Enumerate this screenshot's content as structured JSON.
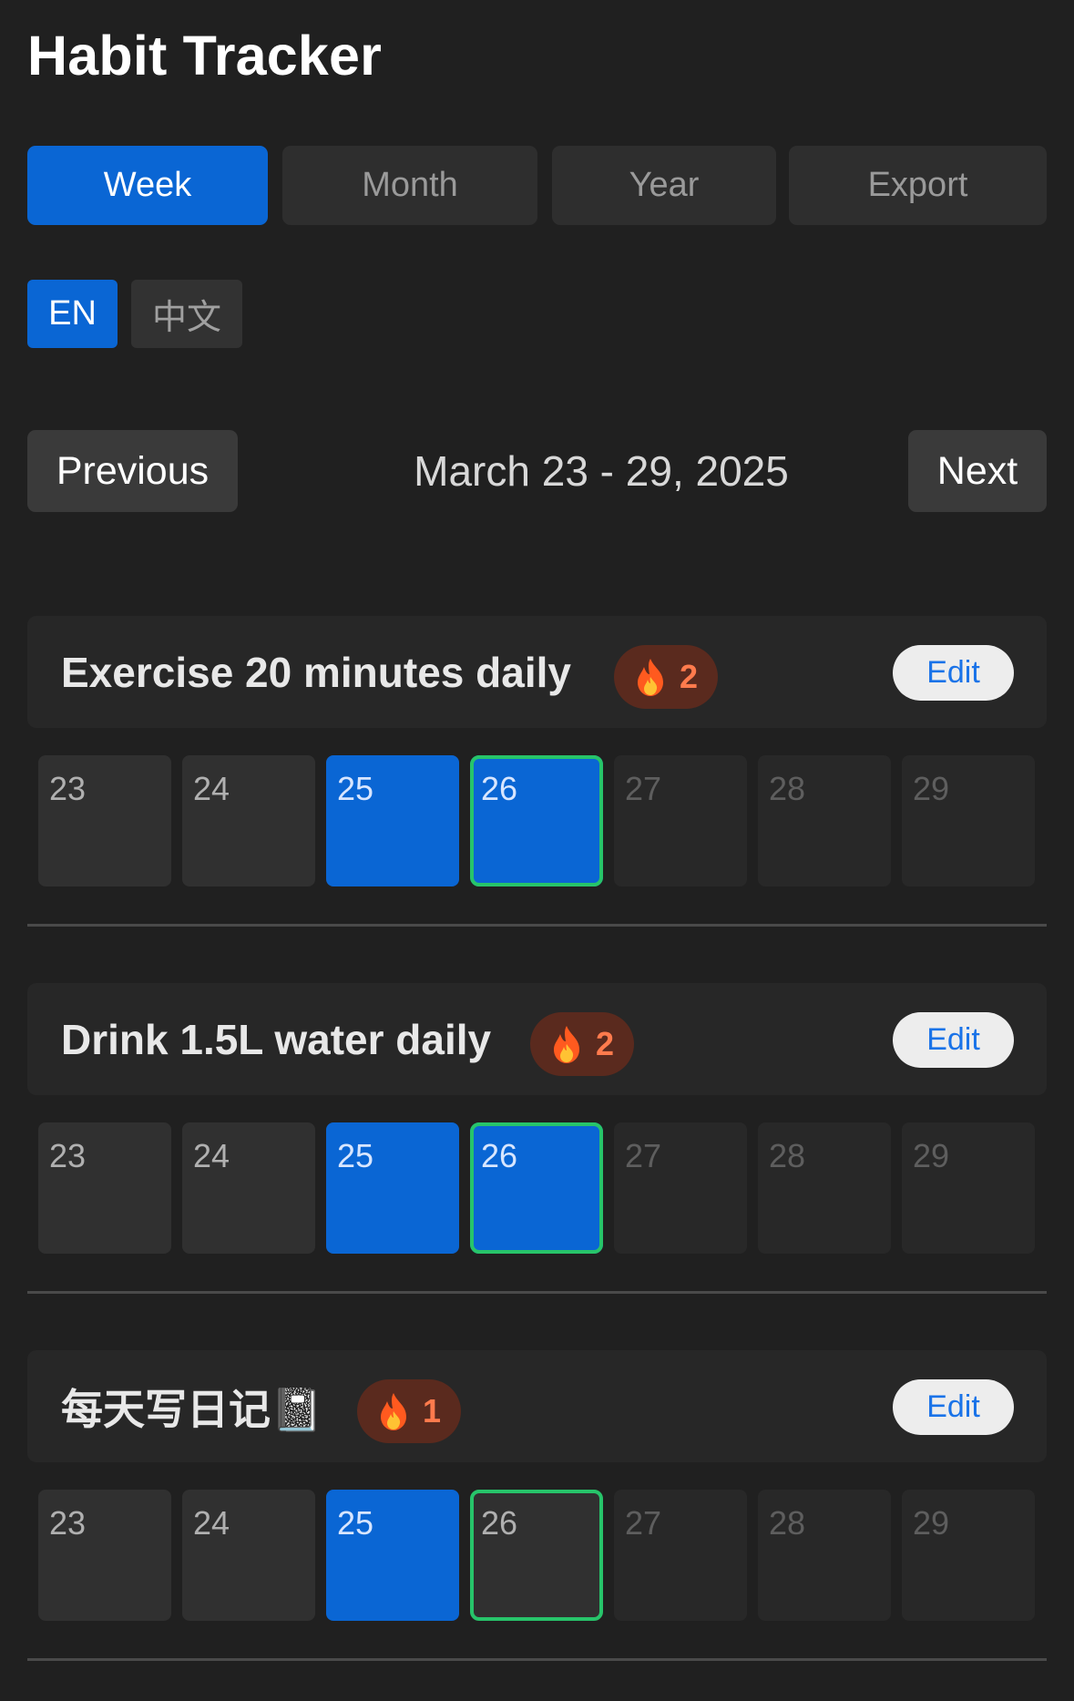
{
  "app": {
    "title": "Habit Tracker"
  },
  "view_tabs": [
    {
      "label": "Week",
      "active": true
    },
    {
      "label": "Month",
      "active": false
    },
    {
      "label": "Year",
      "active": false
    },
    {
      "label": "Export",
      "active": false
    }
  ],
  "language": {
    "options": [
      {
        "label": "EN",
        "active": true
      },
      {
        "label": "中文",
        "active": false
      }
    ]
  },
  "navigation": {
    "previous_label": "Previous",
    "next_label": "Next",
    "range_label": "March 23 - 29, 2025"
  },
  "habits": [
    {
      "name": "Exercise 20 minutes daily",
      "streak": "2",
      "edit_label": "Edit",
      "days": [
        {
          "label": "23",
          "done": false,
          "today": false,
          "future": false
        },
        {
          "label": "24",
          "done": false,
          "today": false,
          "future": false
        },
        {
          "label": "25",
          "done": true,
          "today": false,
          "future": false
        },
        {
          "label": "26",
          "done": true,
          "today": true,
          "future": false
        },
        {
          "label": "27",
          "done": false,
          "today": false,
          "future": true
        },
        {
          "label": "28",
          "done": false,
          "today": false,
          "future": true
        },
        {
          "label": "29",
          "done": false,
          "today": false,
          "future": true
        }
      ]
    },
    {
      "name": "Drink 1.5L water daily",
      "streak": "2",
      "edit_label": "Edit",
      "days": [
        {
          "label": "23",
          "done": false,
          "today": false,
          "future": false
        },
        {
          "label": "24",
          "done": false,
          "today": false,
          "future": false
        },
        {
          "label": "25",
          "done": true,
          "today": false,
          "future": false
        },
        {
          "label": "26",
          "done": true,
          "today": true,
          "future": false
        },
        {
          "label": "27",
          "done": false,
          "today": false,
          "future": true
        },
        {
          "label": "28",
          "done": false,
          "today": false,
          "future": true
        },
        {
          "label": "29",
          "done": false,
          "today": false,
          "future": true
        }
      ]
    },
    {
      "name": "每天写日记📓",
      "streak": "1",
      "edit_label": "Edit",
      "days": [
        {
          "label": "23",
          "done": false,
          "today": false,
          "future": false
        },
        {
          "label": "24",
          "done": false,
          "today": false,
          "future": false
        },
        {
          "label": "25",
          "done": true,
          "today": false,
          "future": false
        },
        {
          "label": "26",
          "done": false,
          "today": true,
          "future": false
        },
        {
          "label": "27",
          "done": false,
          "today": false,
          "future": true
        },
        {
          "label": "28",
          "done": false,
          "today": false,
          "future": true
        },
        {
          "label": "29",
          "done": false,
          "today": false,
          "future": true
        }
      ]
    }
  ],
  "colors": {
    "background": "#202020",
    "accent": "#0a66d4",
    "today_outline": "#27c46a",
    "streak_text": "#ff7b4d",
    "streak_bg": "#5a2a1e"
  },
  "icons": {
    "streak": "fire-icon"
  }
}
